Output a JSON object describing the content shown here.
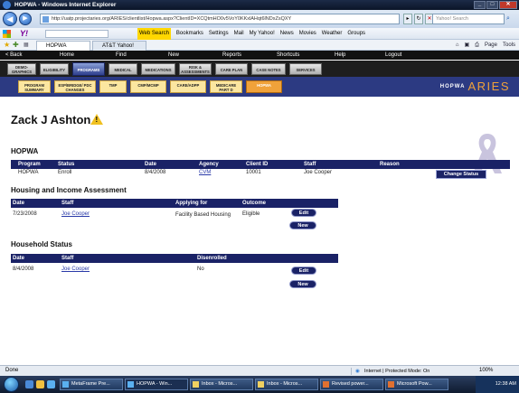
{
  "browser": {
    "title": "HOPWA - Windows Internet Explorer",
    "address": "http://uatp.projectaries.org/ARIES/clientlist/Hopwa.aspx?ClientID=XCQtmHO0v5VoY0KKxlAHqt6lNDxZsQXY",
    "search_placeholder": "Yahoo! Search",
    "toolbar": {
      "web_search": "Web Search",
      "bookmarks": "Bookmarks",
      "settings": "Settings",
      "mail": "Mail",
      "my_yahoo": "My Yahoo!",
      "news": "News",
      "movies": "Movies",
      "weather": "Weather",
      "groups": "Groups"
    },
    "tabs": [
      "HOPWA",
      "AT&T Yahoo!"
    ],
    "right_tools": [
      "Page",
      "Tools"
    ]
  },
  "app_nav": [
    "< Back",
    "Home",
    "Find",
    "New",
    "Reports",
    "Shortcuts",
    "Help",
    "Logout"
  ],
  "module_tabs": [
    {
      "label": "DEMO-GRAPHICS",
      "active": false
    },
    {
      "label": "ELIGIBILITY",
      "active": false
    },
    {
      "label": "PROGRAMS",
      "active": true
    },
    {
      "label": "MEDICAL",
      "active": false
    },
    {
      "label": "MEDICATIONS",
      "active": false
    },
    {
      "label": "RISK & ASSESSMENTS",
      "active": false
    },
    {
      "label": "CARE PLAN",
      "active": false
    },
    {
      "label": "CASE NOTES",
      "active": false
    },
    {
      "label": "SERVICES",
      "active": false
    }
  ],
  "sub_tabs": [
    {
      "label": "PROGRAM SUMMARY",
      "active": false
    },
    {
      "label": "ESP/BRIDGE/ PDC CHANGES",
      "active": false
    },
    {
      "label": "TMP",
      "active": false
    },
    {
      "label": "CMP/MCMP",
      "active": false
    },
    {
      "label": "CARE/ADPP",
      "active": false
    },
    {
      "label": "MEDICARE PART D",
      "active": false
    },
    {
      "label": "HOPWA",
      "active": true
    }
  ],
  "brand": {
    "hopwa": "HOPWA",
    "aries": "ARIES"
  },
  "client": {
    "name": "Zack J Ashton"
  },
  "program_section": {
    "title": "HOPWA",
    "headers": [
      "Program",
      "Status",
      "Date",
      "Agency",
      "Client ID",
      "Staff",
      "Reason"
    ],
    "row": {
      "program": "HOPWA",
      "status": "Enroll",
      "date": "8/4/2008",
      "agency": "CVM",
      "client_id": "10001",
      "staff": "Joe Cooper",
      "reason": ""
    },
    "change_status_label": "Change Status"
  },
  "housing_section": {
    "title": "Housing and Income Assessment",
    "headers": [
      "Date",
      "Staff",
      "Applying for",
      "Outcome"
    ],
    "row": {
      "date": "7/23/2008",
      "staff": "Joe Cooper",
      "applying_for": "Facility Based Housing",
      "outcome": "Eligible"
    },
    "edit_label": "Edit",
    "new_label": "New"
  },
  "household_section": {
    "title": "Household Status",
    "headers": [
      "Date",
      "Staff",
      "Disenrolled"
    ],
    "row": {
      "date": "8/4/2008",
      "staff": "Joe Cooper",
      "disenrolled": "No"
    },
    "edit_label": "Edit",
    "new_label": "New"
  },
  "statusbar": {
    "done": "Done",
    "zone": "Internet | Protected Mode: On",
    "zoom": "100%"
  },
  "taskbar": {
    "buttons": [
      "MetaFrame Pre...",
      "HOPWA - Win...",
      "Inbox - Micros...",
      "Inbox - Micros...",
      "Revised power...",
      "Microsoft Pow..."
    ],
    "time": "12:38 AM"
  },
  "colors": {
    "nav_blue": "#1a2266",
    "accent_orange": "#f0a23a",
    "subnav_bg": "#2c3a82"
  }
}
